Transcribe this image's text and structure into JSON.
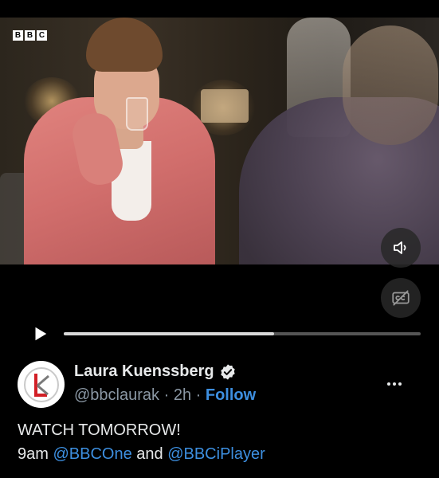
{
  "video": {
    "brand_logo": [
      "B",
      "B",
      "C"
    ],
    "progress_fraction": 0.59,
    "buttons": {
      "mute_icon": "speaker-icon",
      "captions_icon": "captions-off-icon",
      "play_icon": "play-icon"
    }
  },
  "tweet": {
    "author_name": "Laura Kuenssberg",
    "handle": "@bbclaurak",
    "separator": "·",
    "time": "2h",
    "follow_label": "Follow",
    "text_line1": "WATCH TOMORROW!",
    "text_line2_prefix": "9am",
    "mention1": "@BBCOne",
    "text_line2_middle": "and",
    "mention2": "@BBCiPlayer"
  },
  "colors": {
    "accent": "#3d8fe0",
    "background": "#000000",
    "secondary_text": "#8b98a5"
  }
}
